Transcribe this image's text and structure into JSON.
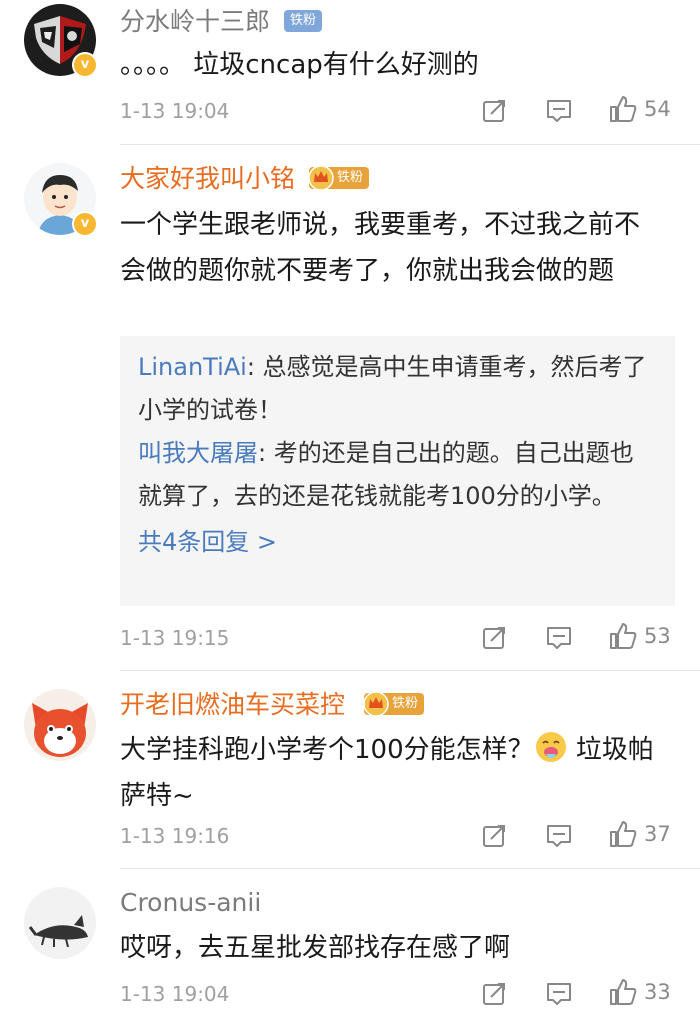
{
  "comments": [
    {
      "username": "分水岭十三郎",
      "fan_badge": "铁粉",
      "text": "。。。。 垃圾cncap有什么好测的",
      "time": "1-13 19:04",
      "likes": "54"
    },
    {
      "username": "大家好我叫小铭",
      "fan_badge": "铁粉",
      "text": "一个学生跟老师说，我要重考，不过我之前不会做的题你就不要考了，你就出我会做的题",
      "replies": [
        {
          "name": "LinanTiAi",
          "text": ": 总感觉是高中生申请重考，然后考了小学的试卷！"
        },
        {
          "name": "叫我大屠屠",
          "text": ": 考的还是自己出的题。自己出题也就算了，去的还是花钱就能考100分的小学。"
        }
      ],
      "more_replies": "共4条回复 >",
      "time": "1-13 19:15",
      "likes": "53"
    },
    {
      "username": "开老旧燃油车买菜控",
      "fan_badge": "铁粉",
      "text_before_emoji": "大学挂科跑小学考个100分能怎样？",
      "text_after_emoji": "垃圾帕萨特~",
      "time": "1-13 19:16",
      "likes": "37"
    },
    {
      "username": "Cronus-anii",
      "text": "哎呀，去五星批发部找存在感了啊",
      "time": "1-13 19:04",
      "likes": "33"
    }
  ],
  "icons": {
    "repost": "repost-icon",
    "comment": "comment-icon",
    "like": "thumbs-up-icon",
    "verified": "verified-v-icon",
    "crown": "crown-icon",
    "emoji": "vomit-emoji-icon"
  },
  "colors": {
    "orange_name": "#e86d20",
    "reply_name": "#4a7bbd",
    "badge_blue": "#7fa7da",
    "badge_gold": "#e8a23a",
    "verified": "#f7b731"
  }
}
